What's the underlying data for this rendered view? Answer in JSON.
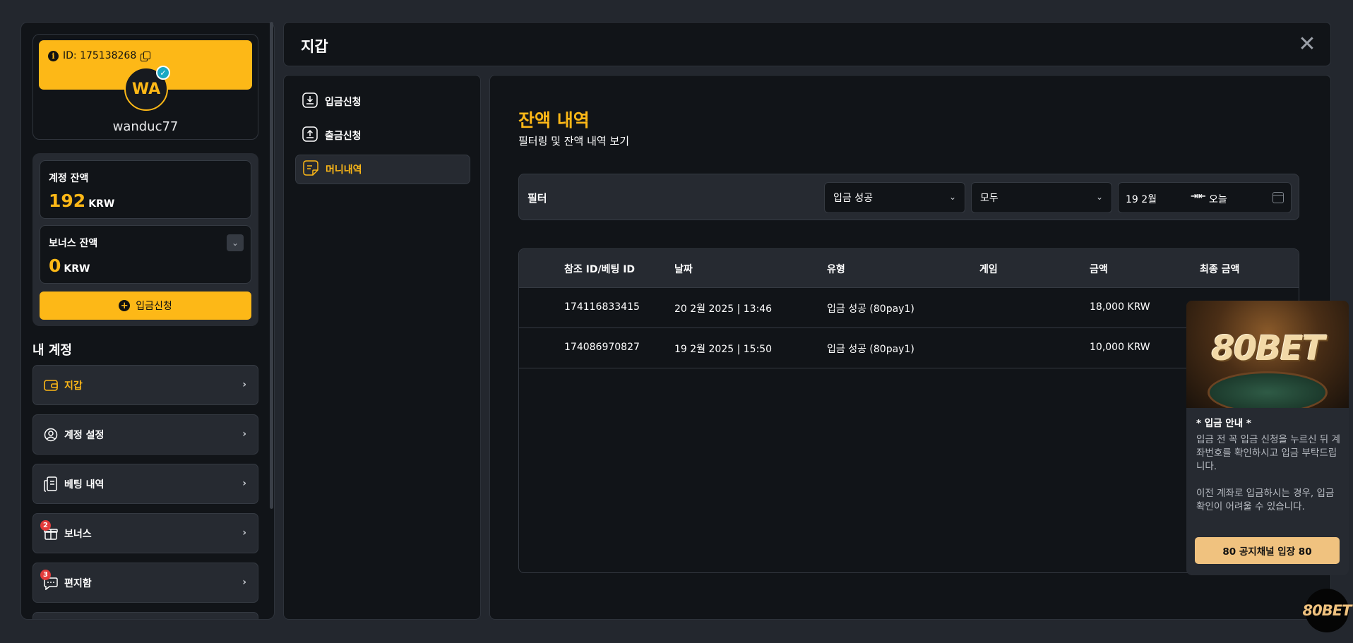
{
  "profile": {
    "id_text": "ID: 175138268",
    "avatar_initials": "WA",
    "username": "wanduc77"
  },
  "balances": {
    "account_label": "계정 잔액",
    "account_value": "192",
    "bonus_label": "보너스 잔액",
    "bonus_value": "0",
    "currency": "KRW",
    "deposit_button": "입금신청"
  },
  "my_account": {
    "title": "내 계정",
    "items": [
      {
        "label": "지갑",
        "icon": "wallet-icon",
        "active": true
      },
      {
        "label": "계정 설정",
        "icon": "user-settings-icon"
      },
      {
        "label": "베팅 내역",
        "icon": "receipt-icon"
      },
      {
        "label": "보너스",
        "icon": "gift-icon",
        "badge": "2"
      },
      {
        "label": "편지함",
        "icon": "message-icon",
        "badge": "3"
      }
    ]
  },
  "wallet": {
    "title": "지갑",
    "nav": [
      {
        "label": "입금신청",
        "icon": "download-icon"
      },
      {
        "label": "출금신청",
        "icon": "upload-icon"
      },
      {
        "label": "머니내역",
        "icon": "document-icon",
        "active": true
      }
    ]
  },
  "history": {
    "title": "잔액 내역",
    "subtitle": "필터링 및 잔액 내역 보기",
    "filter": {
      "label": "필터",
      "type_value": "입금 성공",
      "status_value": "모두",
      "date_from": "19 2월",
      "date_to": "오늘"
    },
    "columns": [
      "참조 ID/베팅 ID",
      "날짜",
      "유형",
      "게임",
      "금액",
      "최종 금액"
    ],
    "rows": [
      {
        "ref": "174116833415",
        "date": "20 2월 2025 | 13:46",
        "type": "입금 성공 (80pay1)",
        "game": "",
        "amount": "18,000 KRW",
        "final": ""
      },
      {
        "ref": "174086970827",
        "date": "19 2월 2025 | 15:50",
        "type": "입금 성공 (80pay1)",
        "game": "",
        "amount": "10,000 KRW",
        "final": ""
      }
    ]
  },
  "promo": {
    "brand": "80BET",
    "heading": "* 입금 안내 *",
    "paragraph1": "입금 전 꼭 입금 신청을 누르신 뒤 계좌번호를 확인하시고 입금 부탁드립니다.",
    "paragraph2": "이전 계좌로 입금하시는 경우, 입금 확인이 어려울 수 있습니다.",
    "button": "80 공지채널 입장 80",
    "fab_label": "80BET"
  },
  "colors": {
    "accent": "#fdb817",
    "background": "#23272e",
    "panel": "#111418",
    "badge": "#e23b3b"
  }
}
